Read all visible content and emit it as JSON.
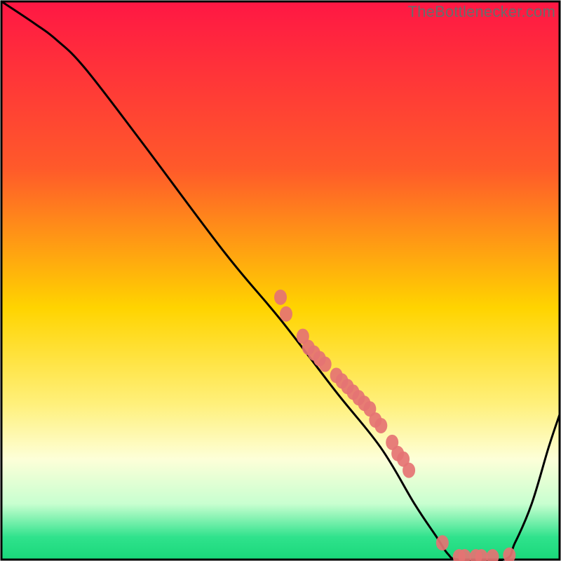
{
  "watermark": "TheBottlenecker.com",
  "chart_data": {
    "type": "line",
    "title": "",
    "xlabel": "",
    "ylabel": "",
    "xlim": [
      0,
      100
    ],
    "ylim": [
      0,
      100
    ],
    "gradient_stops": [
      {
        "offset": 0,
        "color": "#ff1744"
      },
      {
        "offset": 30,
        "color": "#ff5a2a"
      },
      {
        "offset": 55,
        "color": "#ffd400"
      },
      {
        "offset": 72,
        "color": "#fff07a"
      },
      {
        "offset": 82,
        "color": "#fdffd8"
      },
      {
        "offset": 90,
        "color": "#c8ffd0"
      },
      {
        "offset": 96,
        "color": "#2fe28c"
      },
      {
        "offset": 100,
        "color": "#19d87a"
      }
    ],
    "curve": [
      {
        "x": 0,
        "y": 100
      },
      {
        "x": 6,
        "y": 96
      },
      {
        "x": 10,
        "y": 93
      },
      {
        "x": 15,
        "y": 88
      },
      {
        "x": 25,
        "y": 75
      },
      {
        "x": 40,
        "y": 55
      },
      {
        "x": 50,
        "y": 43
      },
      {
        "x": 60,
        "y": 30
      },
      {
        "x": 68,
        "y": 20
      },
      {
        "x": 74,
        "y": 10
      },
      {
        "x": 78,
        "y": 4
      },
      {
        "x": 80,
        "y": 1
      },
      {
        "x": 82,
        "y": 0
      },
      {
        "x": 90,
        "y": 0
      },
      {
        "x": 92,
        "y": 3
      },
      {
        "x": 95,
        "y": 10
      },
      {
        "x": 98,
        "y": 20
      },
      {
        "x": 100,
        "y": 26
      }
    ],
    "points": [
      {
        "x": 50,
        "y": 47
      },
      {
        "x": 51,
        "y": 44
      },
      {
        "x": 54,
        "y": 40
      },
      {
        "x": 55,
        "y": 38
      },
      {
        "x": 56,
        "y": 37
      },
      {
        "x": 57,
        "y": 36
      },
      {
        "x": 58,
        "y": 35
      },
      {
        "x": 60,
        "y": 33
      },
      {
        "x": 61,
        "y": 32
      },
      {
        "x": 62,
        "y": 31
      },
      {
        "x": 63,
        "y": 30
      },
      {
        "x": 64,
        "y": 29
      },
      {
        "x": 65,
        "y": 28
      },
      {
        "x": 66,
        "y": 27
      },
      {
        "x": 67,
        "y": 25
      },
      {
        "x": 68,
        "y": 24
      },
      {
        "x": 70,
        "y": 21
      },
      {
        "x": 71,
        "y": 19
      },
      {
        "x": 72,
        "y": 18
      },
      {
        "x": 73,
        "y": 16
      },
      {
        "x": 79,
        "y": 3
      },
      {
        "x": 82,
        "y": 0.5
      },
      {
        "x": 83,
        "y": 0.5
      },
      {
        "x": 85,
        "y": 0.5
      },
      {
        "x": 86,
        "y": 0.5
      },
      {
        "x": 88,
        "y": 0.5
      },
      {
        "x": 91,
        "y": 0.8
      }
    ]
  }
}
